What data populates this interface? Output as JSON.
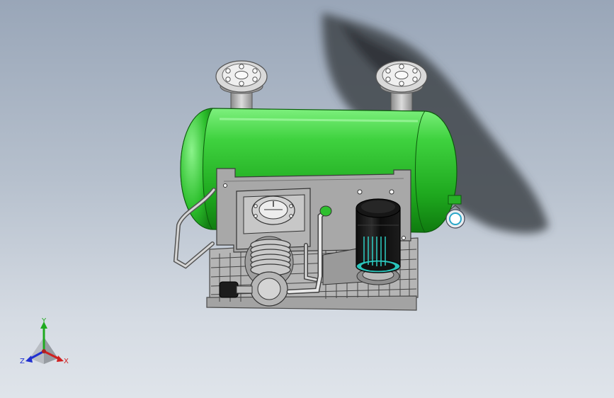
{
  "viewport": {
    "background_top": "#99a6b8",
    "background_bottom": "#dfe4ea"
  },
  "model": {
    "tank_color": "#2fbf2f",
    "frame_color": "#a9a9a9",
    "motor_color": "#1a1a1a",
    "motor_accent": "#3ad3c8"
  },
  "triad": {
    "x_label": "X",
    "y_label": "Y",
    "z_label": "Z",
    "x_color": "#d02020",
    "y_color": "#1faa1f",
    "z_color": "#2030d0"
  }
}
